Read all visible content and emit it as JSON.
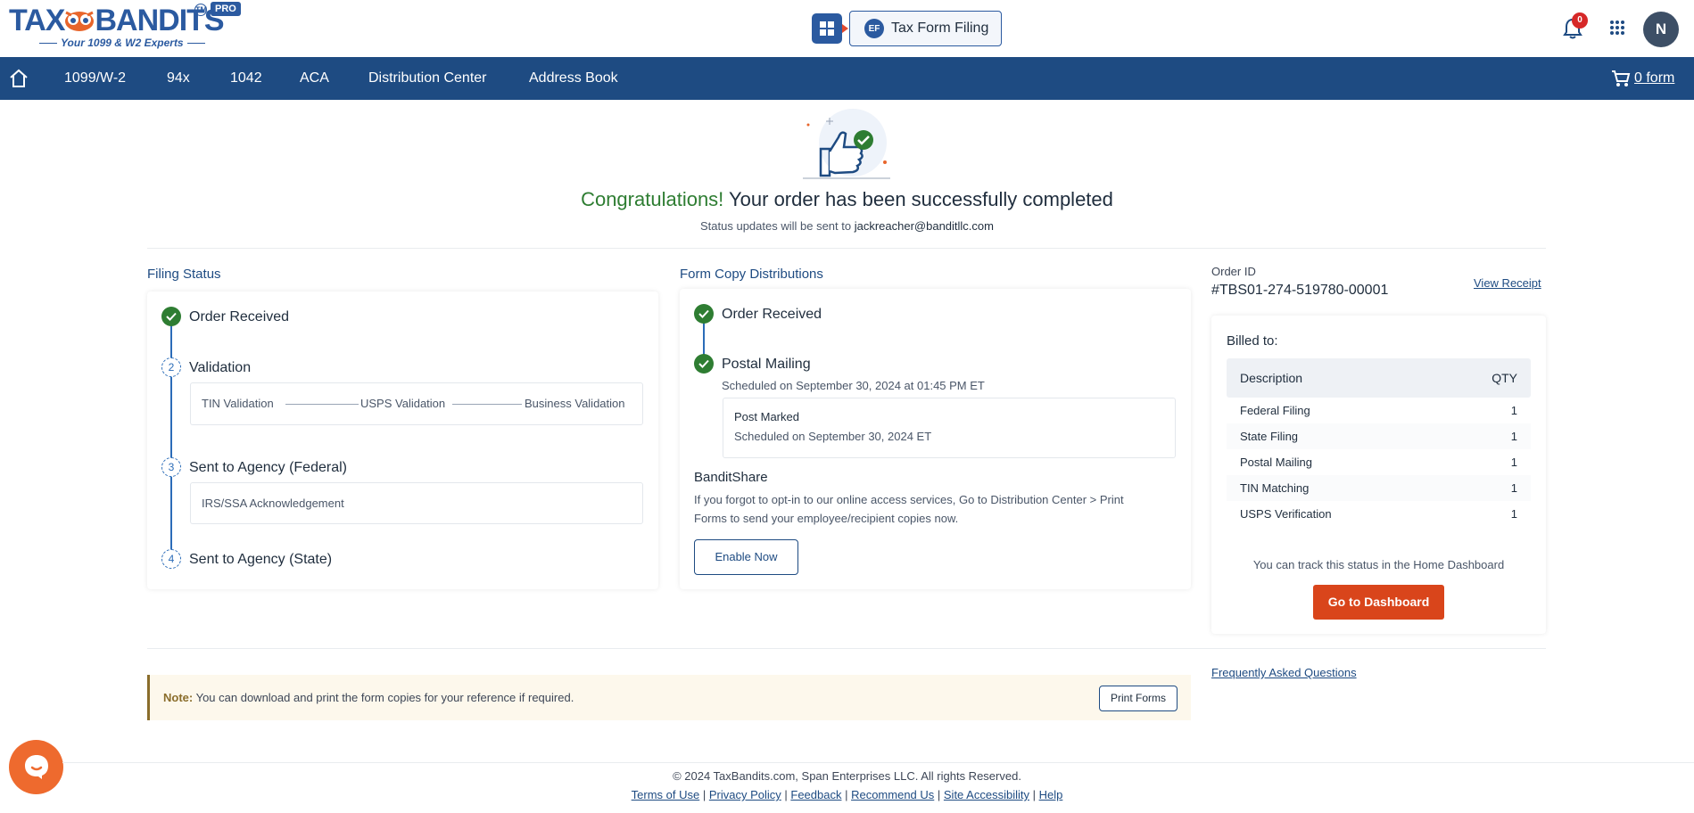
{
  "header": {
    "logo_main_left": "TAX",
    "logo_main_right": "BANDITS",
    "logo_tagline": "Your 1099 & W2 Experts",
    "logo_tm": "TM",
    "pro_badge": "PRO",
    "tax_form_button": "Tax Form Filing",
    "tax_form_icon_text": "EF",
    "notification_count": "0",
    "avatar_initial": "N"
  },
  "nav": {
    "items": [
      "1099/W-2",
      "94x",
      "1042",
      "ACA",
      "Distribution Center",
      "Address Book"
    ],
    "cart_label": "0 form"
  },
  "hero": {
    "congrats": "Congratulations!",
    "message": " Your order has been successfully completed",
    "status_prefix": "Status updates will be sent to ",
    "email": "jackreacher@banditllc.com"
  },
  "filing_status": {
    "title": "Filing Status",
    "steps": [
      {
        "number": "",
        "label": "Order Received"
      },
      {
        "number": "2",
        "label": "Validation"
      },
      {
        "number": "3",
        "label": "Sent to Agency (Federal)"
      },
      {
        "number": "4",
        "label": "Sent to Agency (State)"
      }
    ],
    "validation_items": [
      "TIN Validation",
      "USPS Validation",
      "Business Validation"
    ],
    "federal_ack": "IRS/SSA Acknowledgement"
  },
  "distribution": {
    "title": "Form Copy Distributions",
    "order_received": "Order Received",
    "postal_mailing": "Postal Mailing",
    "postal_scheduled": "Scheduled on September 30, 2024 at 01:45 PM ET",
    "post_marked": "Post Marked",
    "post_marked_scheduled": "Scheduled on September 30, 2024 ET",
    "banditshare_title": "BanditShare",
    "banditshare_text_1": "If you forgot to opt-in to our online access services, Go to Distribution Center > Print",
    "banditshare_text_2": "Forms to send your employee/recipient copies now.",
    "enable_button": "Enable Now"
  },
  "order": {
    "id_label": "Order ID",
    "id_value": "#TBS01-274-519780-00001",
    "view_receipt": "View Receipt",
    "billed_to": "Billed to:",
    "table_headers": [
      "Description",
      "QTY"
    ],
    "rows": [
      {
        "description": "Federal Filing",
        "qty": "1"
      },
      {
        "description": "State Filing",
        "qty": "1"
      },
      {
        "description": "Postal Mailing",
        "qty": "1"
      },
      {
        "description": "TIN Matching",
        "qty": "1"
      },
      {
        "description": "USPS Verification",
        "qty": "1"
      }
    ],
    "track_text": "You can track this status in the Home Dashboard",
    "dashboard_button": "Go to Dashboard"
  },
  "note": {
    "label": "Note:",
    "text": " You can download and print the form copies for your reference if required.",
    "print_button": "Print Forms"
  },
  "faq_link": "Frequently Asked Questions",
  "footer": {
    "copyright": "© 2024 TaxBandits.com, Span Enterprises LLC. All rights Reserved.",
    "links": [
      "Terms of Use",
      "Privacy Policy",
      "Feedback",
      "Recommend Us",
      "Site Accessibility",
      "Help"
    ]
  },
  "colors": {
    "brand_blue": "#1e4b82",
    "success_green": "#2e7d32",
    "cta_orange": "#d9451b",
    "chat_orange": "#ee6a2e",
    "notification_red": "#d62828"
  }
}
